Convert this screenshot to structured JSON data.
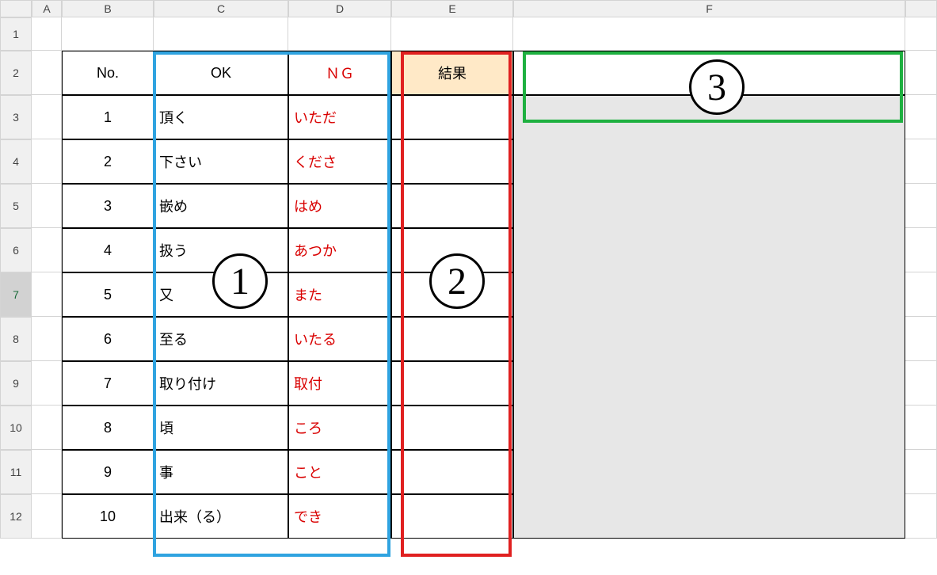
{
  "columns": [
    "A",
    "B",
    "C",
    "D",
    "E",
    "F"
  ],
  "rowCount": 12,
  "selectedRow": 7,
  "headers": {
    "no": "No.",
    "ok": "OK",
    "ng": "ＮＧ",
    "result": "結果"
  },
  "rows": [
    {
      "no": "1",
      "ok": "頂く",
      "ng": "いただ"
    },
    {
      "no": "2",
      "ok": "下さい",
      "ng": "くださ"
    },
    {
      "no": "3",
      "ok": "嵌め",
      "ng": "はめ"
    },
    {
      "no": "4",
      "ok": "扱う",
      "ng": "あつか"
    },
    {
      "no": "5",
      "ok": "又",
      "ng": "また"
    },
    {
      "no": "6",
      "ok": "至る",
      "ng": "いたる"
    },
    {
      "no": "7",
      "ok": "取り付け",
      "ng": "取付"
    },
    {
      "no": "8",
      "ok": "頃",
      "ng": "ころ"
    },
    {
      "no": "9",
      "ok": "事",
      "ng": "こと"
    },
    {
      "no": "10",
      "ok": "出来（る）",
      "ng": "でき"
    }
  ],
  "annotations": {
    "circle1": "1",
    "circle2": "2",
    "circle3": "3"
  }
}
